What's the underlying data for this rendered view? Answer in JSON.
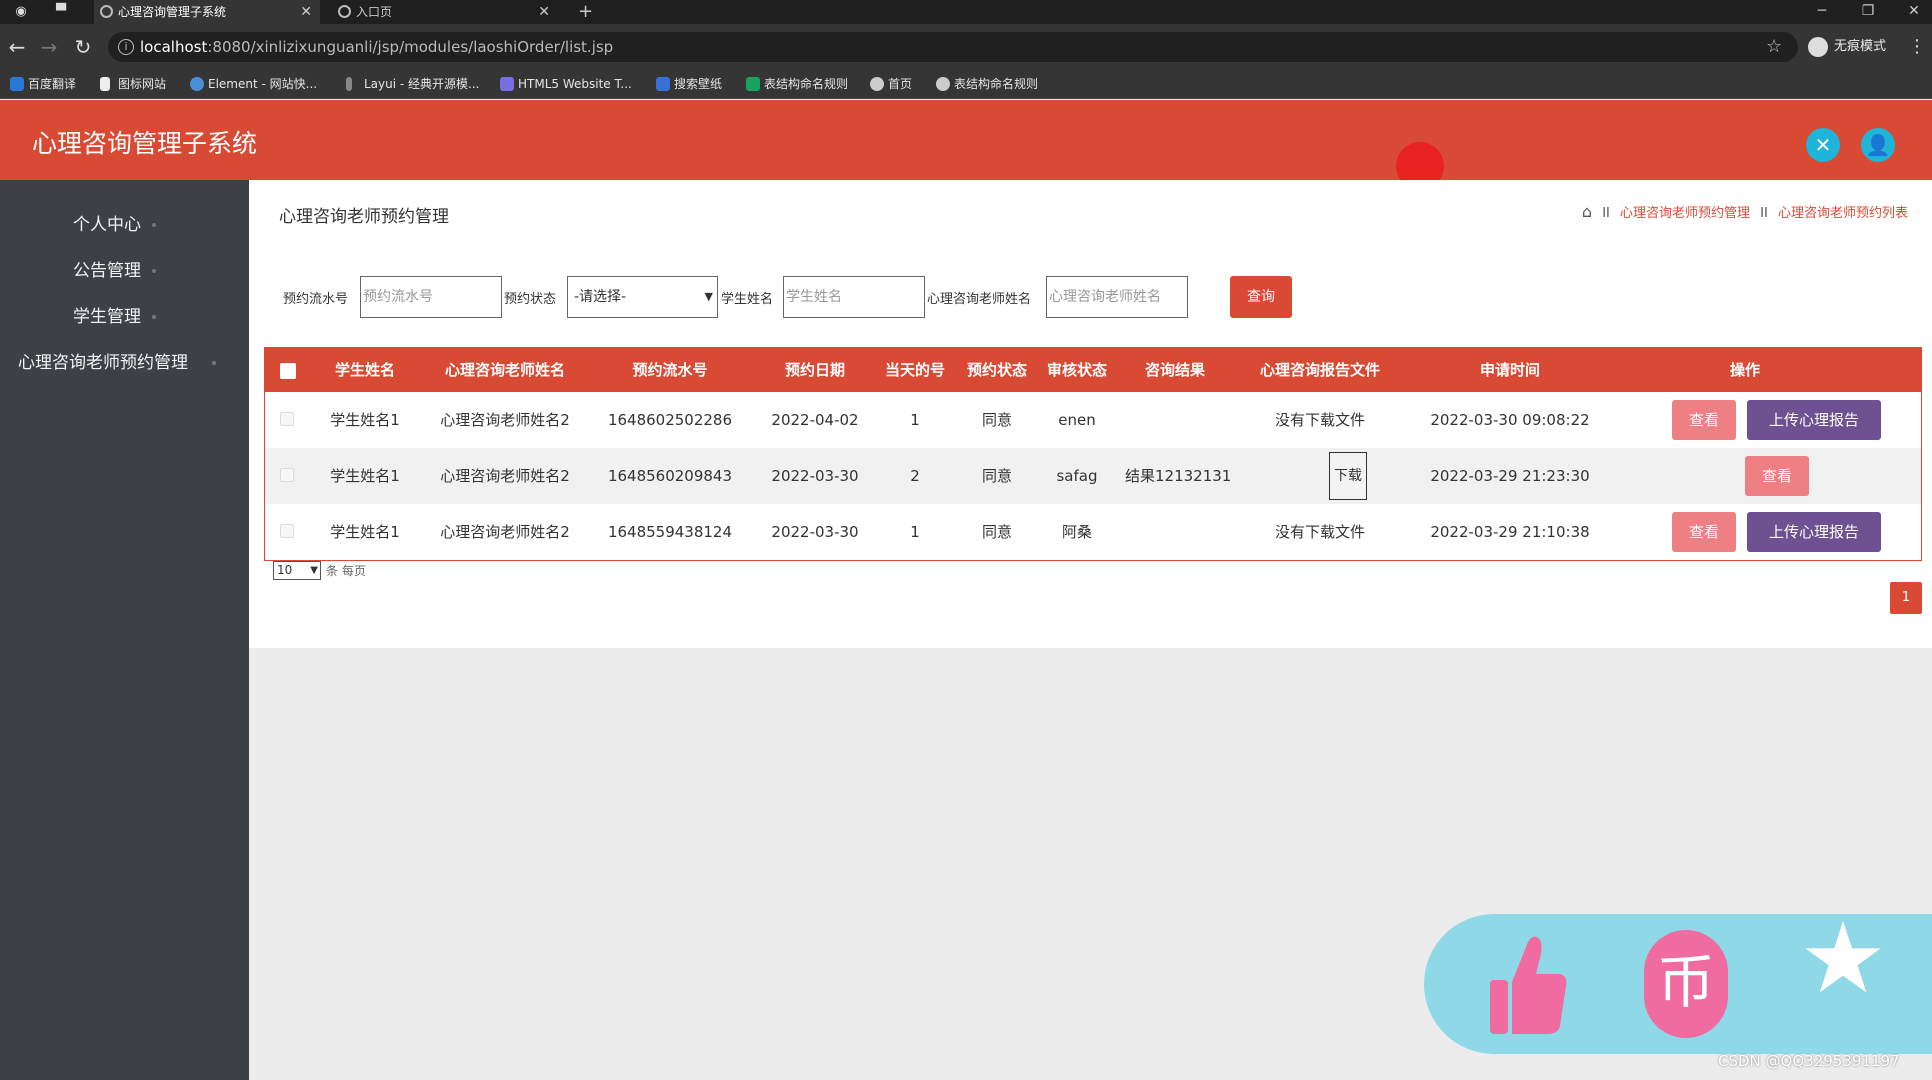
{
  "browser": {
    "tabs": [
      {
        "title": "心理咨询管理子系统",
        "active": true
      },
      {
        "title": "入口页",
        "active": false
      }
    ],
    "new_tab_glyph": "+",
    "window_controls": [
      "─",
      "❐",
      "✕"
    ],
    "url_host": "localhost",
    "url_rest": ":8080/xinlizixunguanli/jsp/modules/laoshiOrder/list.jsp",
    "incognito_label": "无痕模式",
    "bookmarks": [
      {
        "label": "百度翻译",
        "icon": "baidu-translate-icon",
        "color": "#2a7ad5"
      },
      {
        "label": "图标网站",
        "icon": "flag-icon",
        "color": "#eeeeee"
      },
      {
        "label": "Element - 网站快...",
        "icon": "element-icon",
        "color": "#4a90d9"
      },
      {
        "label": "Layui - 经典开源模...",
        "icon": "layui-icon",
        "color": "#888888"
      },
      {
        "label": "HTML5 Website T...",
        "icon": "html5-icon",
        "color": "#7a6ee0"
      },
      {
        "label": "搜索壁纸",
        "icon": "wallpaper-icon",
        "color": "#3a6fd8"
      },
      {
        "label": "表结构命名规则",
        "icon": "sheet-icon",
        "color": "#1aa260"
      },
      {
        "label": "首页",
        "icon": "globe-icon",
        "color": "#cccccc"
      },
      {
        "label": "表结构命名规则",
        "icon": "globe-icon",
        "color": "#cccccc"
      }
    ]
  },
  "app": {
    "title": "心理咨询管理子系统",
    "accent": "#d94a35"
  },
  "sidebar": {
    "items": [
      {
        "label": "个人中心"
      },
      {
        "label": "公告管理"
      },
      {
        "label": "学生管理"
      },
      {
        "label": "心理咨询老师预约管理"
      }
    ]
  },
  "page": {
    "title": "心理咨询老师预约管理",
    "breadcrumb": [
      "心理咨询老师预约管理",
      "心理咨询老师预约列表"
    ],
    "breadcrumb_sep": "II"
  },
  "filters": {
    "order_no_label": "预约流水号",
    "order_no_placeholder": "预约流水号",
    "status_label": "预约状态",
    "status_selected": "-请选择-",
    "student_label": "学生姓名",
    "student_placeholder": "学生姓名",
    "teacher_label": "心理咨询老师姓名",
    "teacher_placeholder": "心理咨询老师姓名",
    "query_button": "查询"
  },
  "table": {
    "headers": [
      "学生姓名",
      "心理咨询老师姓名",
      "预约流水号",
      "预约日期",
      "当天的号",
      "预约状态",
      "审核状态",
      "咨询结果",
      "心理咨询报告文件",
      "申请时间",
      "操作"
    ],
    "rows": [
      {
        "student": "学生姓名1",
        "teacher": "心理咨询老师姓名2",
        "order_no": "1648602502286",
        "date": "2022-04-02",
        "number": "1",
        "status": "同意",
        "review": "enen",
        "result": "",
        "report": "没有下载文件",
        "has_download": false,
        "applied": "2022-03-30 09:08:22",
        "view": "查看",
        "upload": "上传心理报告"
      },
      {
        "student": "学生姓名1",
        "teacher": "心理咨询老师姓名2",
        "order_no": "1648560209843",
        "date": "2022-03-30",
        "number": "2",
        "status": "同意",
        "review": "safag",
        "result": "结果12132131",
        "report": "下载",
        "has_download": true,
        "applied": "2022-03-29 21:23:30",
        "view": "查看",
        "upload": ""
      },
      {
        "student": "学生姓名1",
        "teacher": "心理咨询老师姓名2",
        "order_no": "1648559438124",
        "date": "2022-03-30",
        "number": "1",
        "status": "同意",
        "review": "阿桑",
        "result": "",
        "report": "没有下载文件",
        "has_download": false,
        "applied": "2022-03-29 21:10:38",
        "view": "查看",
        "upload": "上传心理报告"
      }
    ]
  },
  "pagination": {
    "page_size": "10",
    "per_page_label": "条 每页",
    "current_page": "1"
  },
  "watermark": "CSDN @QQ3295391197"
}
